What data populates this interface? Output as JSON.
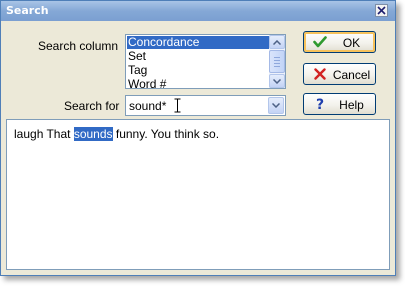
{
  "dialog": {
    "title": "Search"
  },
  "fields": {
    "search_column_label": "Search column",
    "search_for_label": "Search for",
    "search_for_value": "sound*"
  },
  "columns": [
    {
      "label": "Concordance",
      "selected": true
    },
    {
      "label": "Set",
      "selected": false
    },
    {
      "label": "Tag",
      "selected": false
    },
    {
      "label": "Word #",
      "selected": false
    }
  ],
  "buttons": {
    "ok": "OK",
    "cancel": "Cancel",
    "help": "Help"
  },
  "text": {
    "before": "laugh That ",
    "match": "sounds",
    "after": " funny. You think so."
  },
  "colors": {
    "title_bar": "#7b9fd1",
    "selection": "#316ac5",
    "ok_icon": "#2f9a2f",
    "cancel_icon": "#d22323",
    "help_icon": "#1f3fae"
  },
  "icons": {
    "close": "close-icon",
    "ok": "check-icon",
    "cancel": "x-icon",
    "help": "question-mark-icon"
  }
}
